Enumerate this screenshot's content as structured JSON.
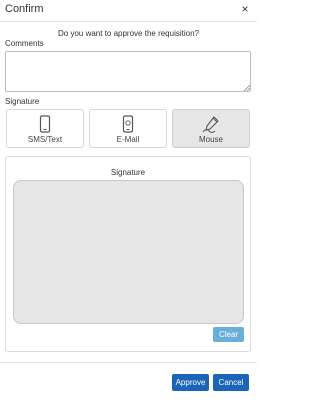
{
  "dialog": {
    "title": "Confirm",
    "close_glyph": "×",
    "question": "Do you want to approve the requisition?",
    "comments_label": "Comments",
    "comments_value": "",
    "signature_label": "Signature",
    "options": [
      {
        "label": "SMS/Text",
        "icon": "mobile-phone-icon",
        "selected": false
      },
      {
        "label": "E-Mail",
        "icon": "email-phone-icon",
        "selected": false
      },
      {
        "label": "Mouse",
        "icon": "mouse-signature-icon",
        "selected": true
      }
    ],
    "panel_title": "Signature",
    "clear_label": "Clear",
    "approve_label": "Approve",
    "cancel_label": "Cancel"
  },
  "colors": {
    "primary": "#1c64b8",
    "clear": "#5aa7d8",
    "pad": "#e6e6e6",
    "selected": "#e6e6e6"
  }
}
